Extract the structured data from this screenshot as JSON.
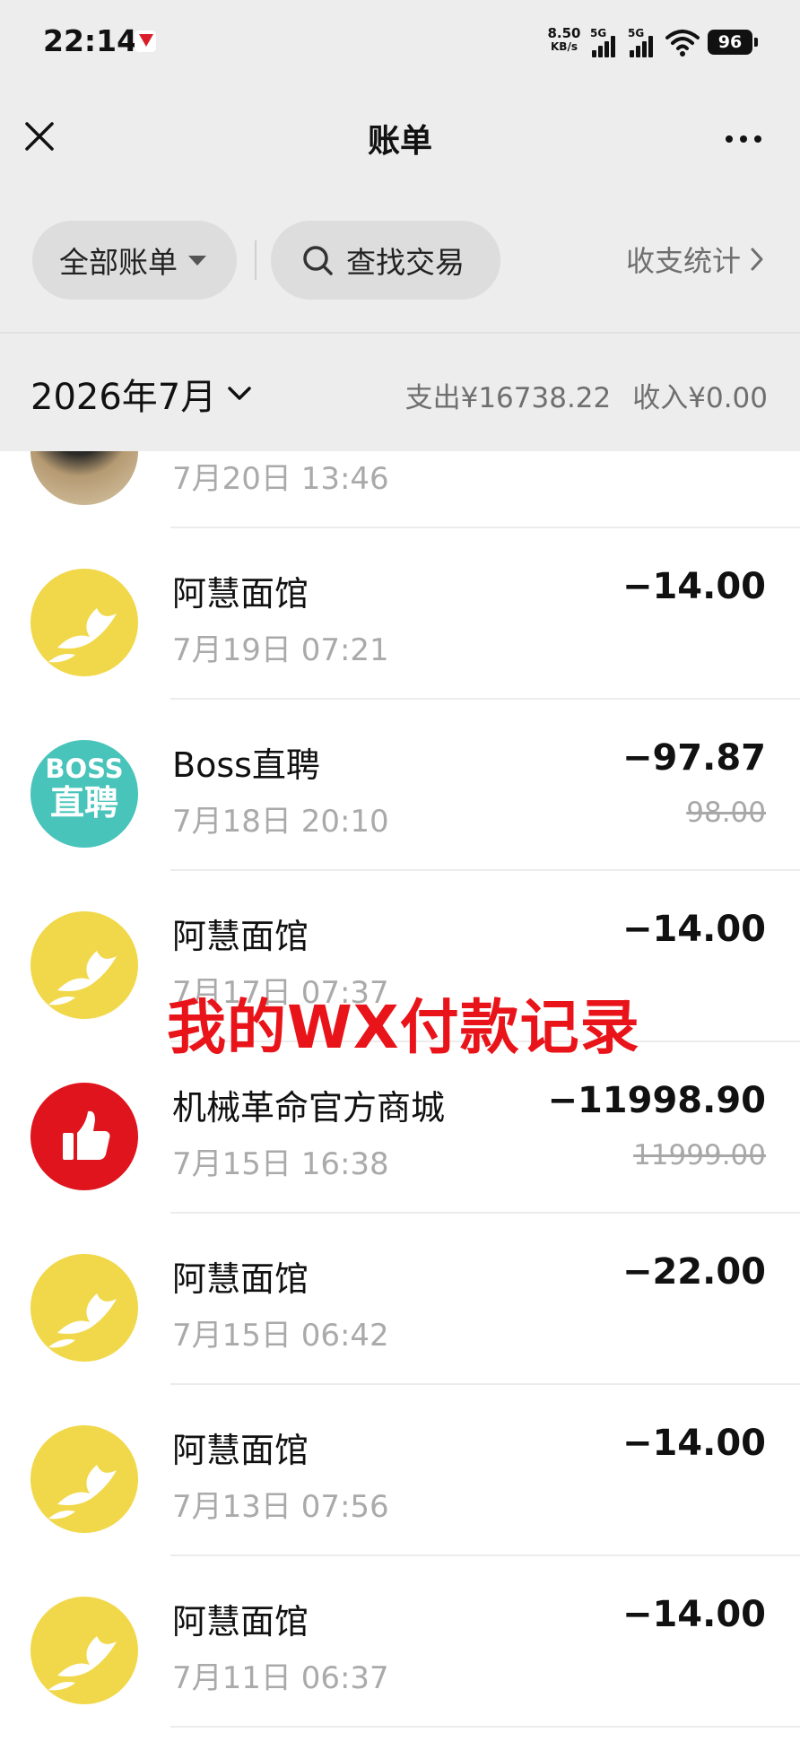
{
  "status_bar": {
    "time": "22:14",
    "net_speed": "8.50",
    "net_unit": "KB/s",
    "signal_1": "5G",
    "signal_2": "5G",
    "battery": "96"
  },
  "nav": {
    "title": "账单",
    "close_icon": "close-icon",
    "more_icon": "more-icon"
  },
  "filters": {
    "all_bills": "全部账单",
    "search": "查找交易",
    "stats": "收支统计"
  },
  "summary": {
    "month": "2026年7月",
    "expense": "支出¥16738.22",
    "income": "收入¥0.00"
  },
  "transactions": [
    {
      "name": "",
      "date": "7月20日 13:46",
      "amount": "",
      "original": "",
      "avatar": "photo"
    },
    {
      "name": "阿慧面馆",
      "date": "7月19日 07:21",
      "amount": "−14.00",
      "original": "",
      "avatar": "yellow-bird"
    },
    {
      "name": "Boss直聘",
      "date": "7月18日 20:10",
      "amount": "−97.87",
      "original": "98.00",
      "avatar": "boss"
    },
    {
      "name": "阿慧面馆",
      "date": "7月17日 07:37",
      "amount": "−14.00",
      "original": "",
      "avatar": "yellow-bird"
    },
    {
      "name": "机械革命官方商城",
      "date": "7月15日 16:38",
      "amount": "−11998.90",
      "original": "11999.00",
      "avatar": "thumbs-up"
    },
    {
      "name": "阿慧面馆",
      "date": "7月15日 06:42",
      "amount": "−22.00",
      "original": "",
      "avatar": "yellow-bird"
    },
    {
      "name": "阿慧面馆",
      "date": "7月13日 07:56",
      "amount": "−14.00",
      "original": "",
      "avatar": "yellow-bird"
    },
    {
      "name": "阿慧面馆",
      "date": "7月11日 06:37",
      "amount": "−14.00",
      "original": "",
      "avatar": "yellow-bird"
    }
  ],
  "boss_logo": {
    "line1": "BOSS",
    "line2": "直聘"
  },
  "watermark": "我的WX付款记录",
  "colors": {
    "background_header": "#ededed",
    "avatar_yellow": "#f1d84a",
    "boss_teal": "#49c4bb",
    "thumb_red": "#e0141d",
    "watermark_red": "#e8141a"
  }
}
